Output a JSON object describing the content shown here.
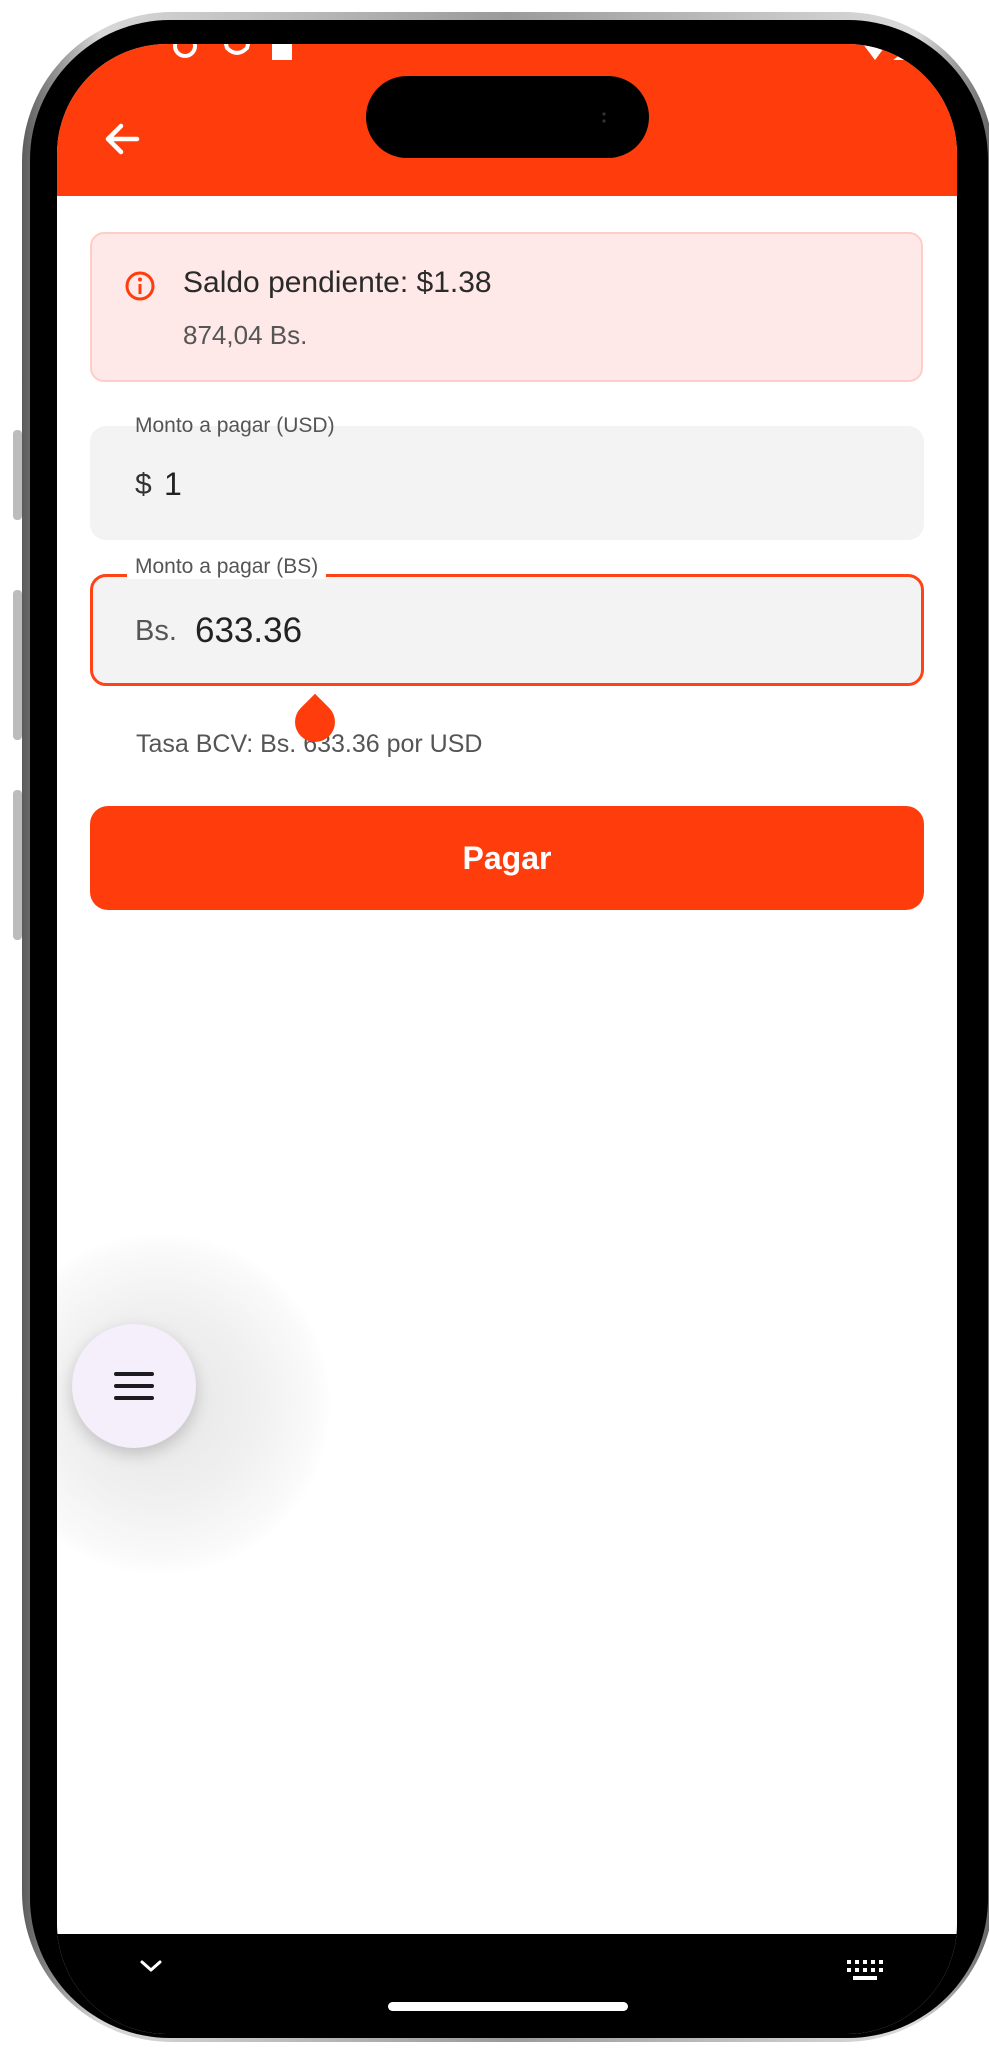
{
  "app_bar": {
    "status_icons": [
      "notification-icon",
      "shield-icon",
      "square-icon"
    ],
    "signal_icons": [
      "wifi-icon",
      "signal-icon"
    ],
    "back_icon": "arrow-left-icon",
    "accent_color": "#ff3d0c"
  },
  "alert": {
    "icon": "info-icon",
    "title": "Saldo pendiente: $1.38",
    "subtitle": "874,04 Bs."
  },
  "usd_field": {
    "label": "Monto a pagar (USD)",
    "prefix": "$",
    "value": "1"
  },
  "bs_field": {
    "label": "Monto a pagar (BS)",
    "prefix": "Bs.",
    "value": "633.36"
  },
  "rate_hint": "Tasa BCV: Bs. 633.36 por USD",
  "pay_button": {
    "label": "Pagar"
  },
  "fab": {
    "icon": "menu-icon"
  },
  "nav_bar": {
    "left_icon": "chevron-down-icon",
    "right_icon": "keyboard-icon"
  }
}
